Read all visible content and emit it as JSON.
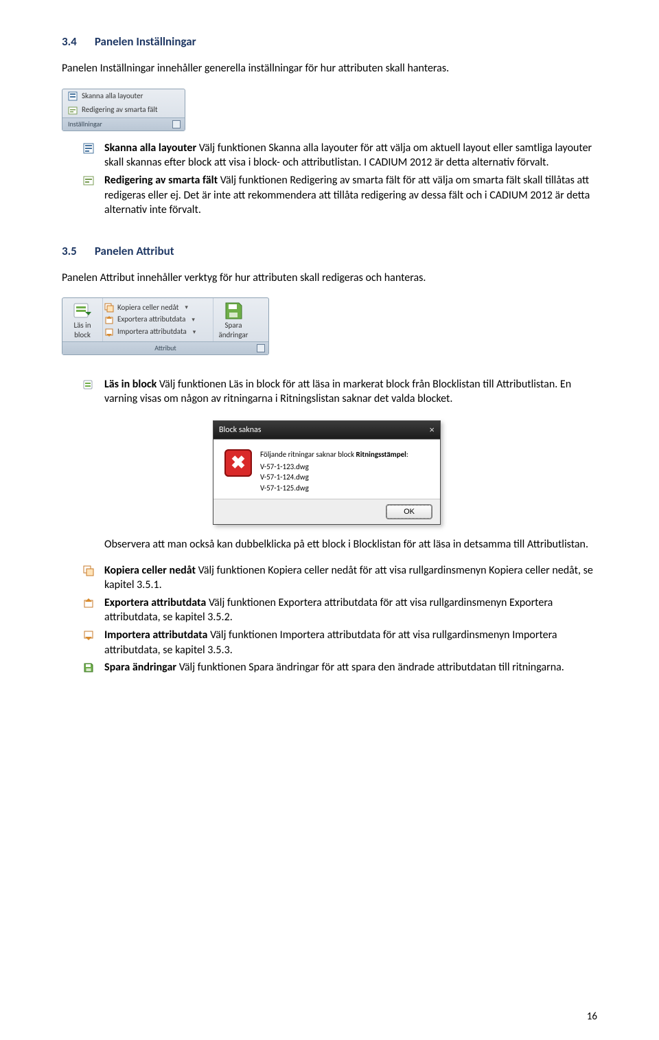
{
  "section34": {
    "number": "3.4",
    "title": "Panelen Inställningar",
    "intro": "Panelen Inställningar innehåller generella inställningar för hur attributen skall hanteras."
  },
  "inst_panel": {
    "row1": "Skanna alla layouter",
    "row2": "Redigering av smarta fält",
    "footer": "Inställningar"
  },
  "inst_bullets": [
    {
      "bold": "Skanna alla layouter",
      "text": " Välj funktionen Skanna alla layouter för att välja om aktuell layout eller samtliga layouter skall skannas efter block att visa i block- och attributlistan. I CADIUM 2012 är detta alternativ förvalt."
    },
    {
      "bold": "Redigering av smarta fält",
      "text": " Välj funktionen Redigering av smarta fält för att välja om smarta fält skall tillåtas att redigeras eller ej. Det är inte att rekommendera att tillåta redigering av dessa fält och i CADIUM 2012 är detta alternativ inte förvalt."
    }
  ],
  "section35": {
    "number": "3.5",
    "title": "Panelen Attribut",
    "intro": "Panelen Attribut innehåller verktyg för hur attributen skall redigeras och hanteras."
  },
  "attr_panel": {
    "lasin_line1": "Läs in",
    "lasin_line2": "block",
    "row1": "Kopiera celler nedåt",
    "row2": "Exportera attributdata",
    "row3": "Importera attributdata",
    "spara_line1": "Spara",
    "spara_line2": "ändringar",
    "footer": "Attribut"
  },
  "attr_bullet1": {
    "bold": "Läs in block",
    "text": " Välj funktionen Läs in block för att läsa in markerat block från Blocklistan till Attributlistan. En varning visas om någon av ritningarna i Ritningslistan saknar det valda blocket."
  },
  "dialog": {
    "title": "Block saknas",
    "msg_prefix": "Följande ritningar saknar block ",
    "msg_bold": "Ritningsstämpel",
    "msg_suffix": ":",
    "files": [
      "V-57-1-123.dwg",
      "V-57-1-124.dwg",
      "V-57-1-125.dwg"
    ],
    "ok": "OK"
  },
  "observera": "Observera att man också kan dubbelklicka på ett block i Blocklistan för att läsa in detsamma till Attributlistan.",
  "attr_bullets_rest": [
    {
      "bold": "Kopiera celler nedåt",
      "text": " Välj funktionen Kopiera celler nedåt för att visa rullgardinsmenyn Kopiera celler nedåt, se kapitel 3.5.1."
    },
    {
      "bold": "Exportera attributdata",
      "text": " Välj funktionen Exportera attributdata för att visa rullgardinsmenyn Exportera attributdata, se kapitel 3.5.2."
    },
    {
      "bold": "Importera attributdata",
      "text": " Välj funktionen Importera attributdata för att visa rullgardinsmenyn Importera attributdata, se kapitel 3.5.3."
    },
    {
      "bold": "Spara ändringar",
      "text": " Välj funktionen Spara ändringar för att spara den ändrade attributdatan till ritningarna."
    }
  ],
  "page_number": "16"
}
